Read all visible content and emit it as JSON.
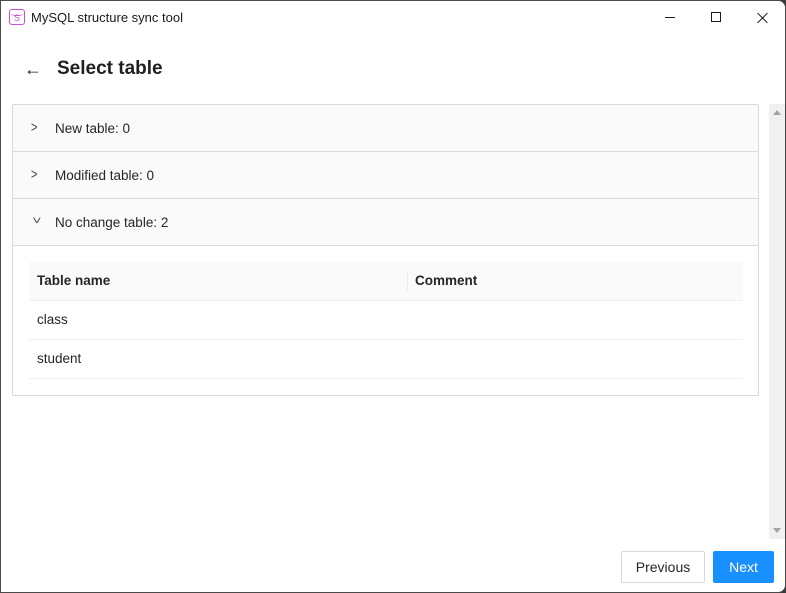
{
  "window": {
    "title": "MySQL structure sync tool",
    "app_icon_glyph": "S",
    "controls": {
      "minimize": "minimize-icon",
      "maximize": "maximize-icon",
      "close": "close-icon"
    }
  },
  "header": {
    "back_icon": "←",
    "title": "Select table"
  },
  "collapse": {
    "panels": [
      {
        "label": "New table: 0",
        "expanded": false,
        "arrow": ">"
      },
      {
        "label": "Modified table: 0",
        "expanded": false,
        "arrow": ">"
      },
      {
        "label": "No change table: 2",
        "expanded": true,
        "arrow": ">"
      }
    ]
  },
  "table": {
    "columns": [
      "Table name",
      "Comment"
    ],
    "rows": [
      {
        "name": "class",
        "comment": ""
      },
      {
        "name": "student",
        "comment": ""
      }
    ]
  },
  "footer": {
    "previous_label": "Previous",
    "next_label": "Next"
  },
  "colors": {
    "primary": "#1890ff",
    "app_icon": "#c94fd8",
    "panel_bg": "#fafafa",
    "border": "#d9d9d9"
  }
}
